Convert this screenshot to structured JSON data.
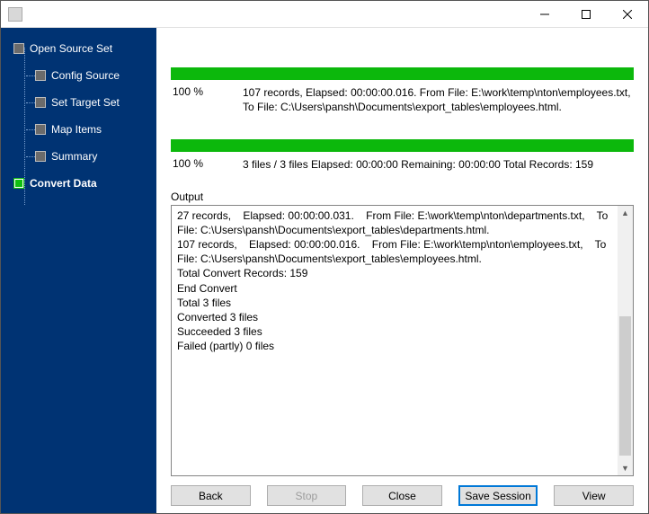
{
  "sidebar": {
    "items": [
      {
        "label": "Open Source Set",
        "active": false,
        "child": false
      },
      {
        "label": "Config Source",
        "active": false,
        "child": true
      },
      {
        "label": "Set Target Set",
        "active": false,
        "child": true
      },
      {
        "label": "Map Items",
        "active": false,
        "child": true
      },
      {
        "label": "Summary",
        "active": false,
        "child": true
      },
      {
        "label": "Convert Data",
        "active": true,
        "child": false
      }
    ]
  },
  "progress": {
    "file": {
      "pct": "100 %",
      "text": "107 records,    Elapsed: 00:00:00.016.    From File: E:\\work\\temp\\nton\\employees.txt,    To File: C:\\Users\\pansh\\Documents\\export_tables\\employees.html."
    },
    "total": {
      "pct": "100 %",
      "text": "3 files / 3 files    Elapsed: 00:00:00    Remaining: 00:00:00    Total Records: 159"
    }
  },
  "output": {
    "label": "Output",
    "text": "27 records,    Elapsed: 00:00:00.031.    From File: E:\\work\\temp\\nton\\departments.txt,    To File: C:\\Users\\pansh\\Documents\\export_tables\\departments.html.\n107 records,    Elapsed: 00:00:00.016.    From File: E:\\work\\temp\\nton\\employees.txt,    To File: C:\\Users\\pansh\\Documents\\export_tables\\employees.html.\nTotal Convert Records: 159\nEnd Convert\nTotal 3 files\nConverted 3 files\nSucceeded 3 files\nFailed (partly) 0 files"
  },
  "buttons": {
    "back": "Back",
    "stop": "Stop",
    "close": "Close",
    "save": "Save Session",
    "view": "View"
  }
}
